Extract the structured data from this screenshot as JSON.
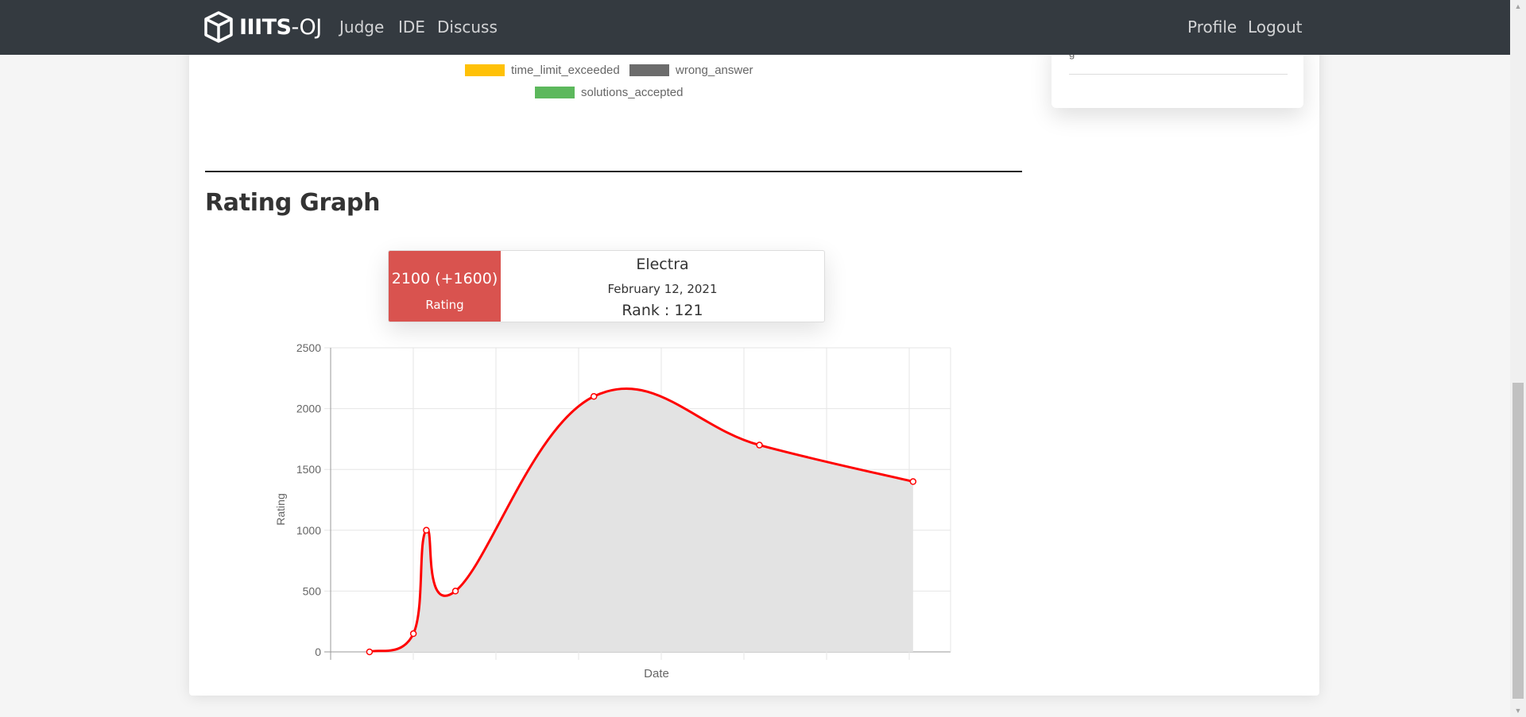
{
  "navbar": {
    "brand_bold": "IIITS",
    "brand_rest": "-OJ",
    "links": [
      "Judge",
      "IDE",
      "Discuss"
    ],
    "right_links": [
      "Profile",
      "Logout"
    ]
  },
  "side_card": {
    "text": "g"
  },
  "verdict_legend": [
    {
      "label": "time_limit_exceeded",
      "color": "#ffc107"
    },
    {
      "label": "wrong_answer",
      "color": "#6c6c6c"
    },
    {
      "label": "solutions_accepted",
      "color": "#5cb85c"
    }
  ],
  "section": {
    "title": "Rating Graph"
  },
  "tooltip": {
    "rating": "2100 (+1600)",
    "rating_label": "Rating",
    "contest": "Electra",
    "date": "February 12, 2021",
    "rank": "Rank : 121",
    "color": "#d9534f"
  },
  "chart_data": {
    "type": "line",
    "xlabel": "Date",
    "ylabel": "Rating",
    "ylim": [
      0,
      2500
    ],
    "y_ticks": [
      0,
      500,
      1000,
      1500,
      2000,
      2500
    ],
    "grid": true,
    "fill": true,
    "line_color": "#ff0000",
    "fill_color": "#e3e3e3",
    "series": [
      {
        "values": [
          0,
          150,
          1000,
          500,
          2100,
          1700,
          1400
        ]
      }
    ]
  },
  "icons": {
    "brand": "cube-icon",
    "scroll_up": "triangle-up-icon",
    "scroll_down": "triangle-down-icon"
  }
}
